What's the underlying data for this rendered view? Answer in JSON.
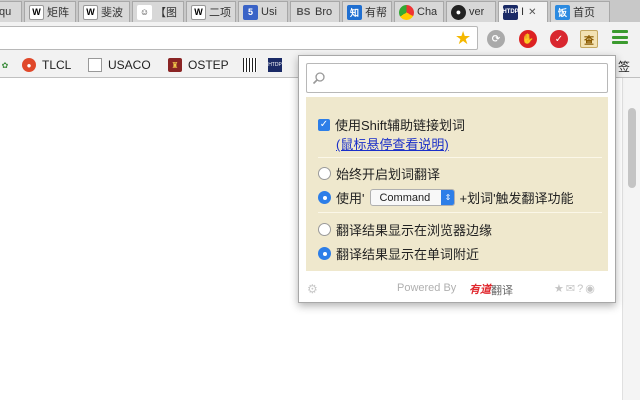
{
  "tabs": [
    {
      "label": "qu",
      "icon": "generic-icon"
    },
    {
      "label": "矩阵",
      "icon": "wikipedia-icon"
    },
    {
      "label": "斐波",
      "icon": "wikipedia-icon"
    },
    {
      "label": "【图",
      "icon": "bilibili-icon"
    },
    {
      "label": "二项",
      "icon": "wikipedia-icon"
    },
    {
      "label": "Usi",
      "icon": "html5-icon"
    },
    {
      "label": "Bro",
      "icon": "bs-icon"
    },
    {
      "label": "有帮",
      "icon": "zhihu-icon"
    },
    {
      "label": "Cha",
      "icon": "chrome-icon"
    },
    {
      "label": "ver",
      "icon": "github-icon"
    },
    {
      "label": "I",
      "icon": "ostep-icon"
    },
    {
      "label": "首页",
      "icon": "fanyi-icon"
    }
  ],
  "bookmarks": [
    {
      "label": "TLCL",
      "icon": "weibo-icon"
    },
    {
      "label": "USACO",
      "icon": "page-icon"
    },
    {
      "label": "OSTEP",
      "icon": "crest-icon"
    }
  ],
  "bookmarks_overflow": "签",
  "popup": {
    "search": {
      "value": "",
      "placeholder": ""
    },
    "shift_option": "使用Shift辅助链接划词",
    "hover_help_link": "(鼠标悬停查看说明)",
    "always_on": "始终开启划词翻译",
    "use_prefix": "使用'",
    "key_select": "Command",
    "use_suffix": "+划词'触发翻译功能",
    "show_at_edge": "翻译结果显示在浏览器边缘",
    "show_near_word": "翻译结果显示在单词附近",
    "powered_by": "Powered By",
    "brand": "有道",
    "brand_suffix": "翻译"
  },
  "colors": {
    "accent": "#2d7ee8",
    "settings_bg": "#efe8cd",
    "link": "#1a2fc9",
    "brand_red": "#e0282e"
  }
}
